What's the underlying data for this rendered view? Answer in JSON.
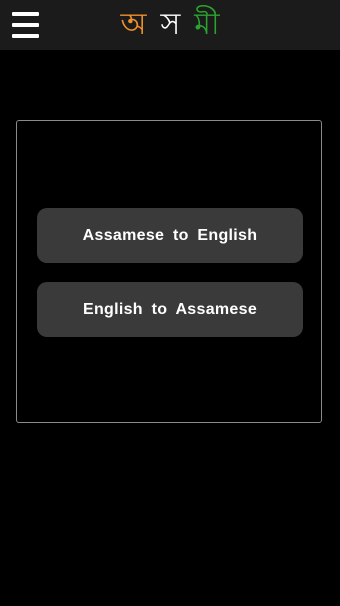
{
  "app_bar": {
    "menu_icon": "hamburger-menu-icon",
    "title_letters": [
      {
        "char": "অ",
        "color": "#f0922a"
      },
      {
        "char": "স",
        "color": "#ffffff"
      },
      {
        "char": "মী",
        "color": "#2aa32f"
      }
    ]
  },
  "main": {
    "buttons": [
      {
        "label": "Assamese to English"
      },
      {
        "label": "English to Assamese"
      }
    ]
  },
  "colors": {
    "background": "#000000",
    "app_bar": "#1b1b1b",
    "button_bg": "#3a3a3a",
    "panel_border": "#8a8a8a"
  }
}
